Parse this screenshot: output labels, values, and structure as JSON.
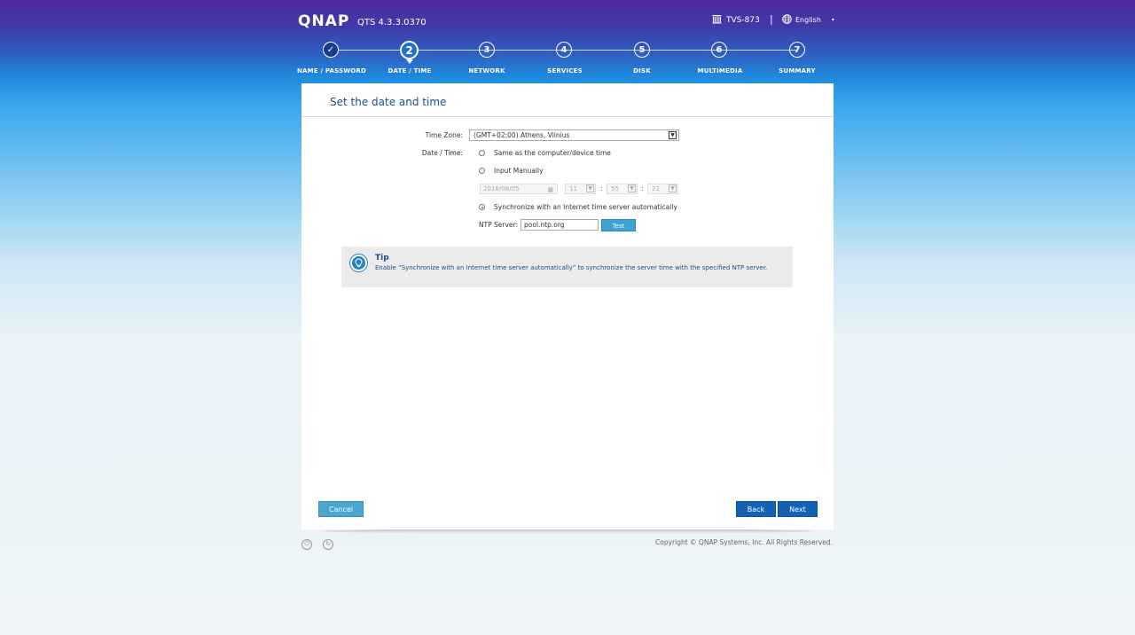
{
  "header": {
    "logo": "QNAP",
    "version": "QTS 4.3.3.0370",
    "device_name": "TVS-873",
    "separator": "|",
    "language": "English",
    "language_caret": "▾",
    "device_icon": "building-columns-icon",
    "language_icon": "globe-icon"
  },
  "wizard": {
    "steps": [
      {
        "number": "✓",
        "label": "NAME / PASSWORD",
        "state": "done"
      },
      {
        "number": "2",
        "label": "DATE / TIME",
        "state": "active"
      },
      {
        "number": "3",
        "label": "NETWORK",
        "state": "pending"
      },
      {
        "number": "4",
        "label": "SERVICES",
        "state": "pending"
      },
      {
        "number": "5",
        "label": "DISK",
        "state": "pending"
      },
      {
        "number": "6",
        "label": "MULTIMEDIA",
        "state": "pending"
      },
      {
        "number": "7",
        "label": "SUMMARY",
        "state": "pending"
      }
    ]
  },
  "panel": {
    "title": "Set the date and time",
    "time_zone_label": "Time Zone:",
    "time_zone_value": "(GMT+02:00) Athens, Vilnius",
    "date_time_label": "Date / Time:",
    "options": {
      "same_as_computer": "Same as the computer/device time",
      "input_manually": "Input Manually",
      "sync_ntp": "Synchronize with an Internet time server automatically"
    },
    "selected_option": "sync_ntp",
    "manual": {
      "date": "2018/08/05",
      "hour": "11",
      "minute": "55",
      "second": "21",
      "separator": ":"
    },
    "ntp_label": "NTP Server:",
    "ntp_value": "pool.ntp.org",
    "test_button": "Test",
    "tip": {
      "title": "Tip",
      "text": "Enable “Synchronize with an Internet time server automatically” to synchronize the server time with the specified NTP server."
    },
    "cancel_button": "Cancel",
    "back_button": "Back",
    "next_button": "Next"
  },
  "footer": {
    "copyright": "Copyright © QNAP Systems, Inc. All Rights Reserved."
  },
  "colors": {
    "accent": "#1462b5",
    "test_button": "#3fa3d4",
    "title": "#1a4e8c"
  }
}
